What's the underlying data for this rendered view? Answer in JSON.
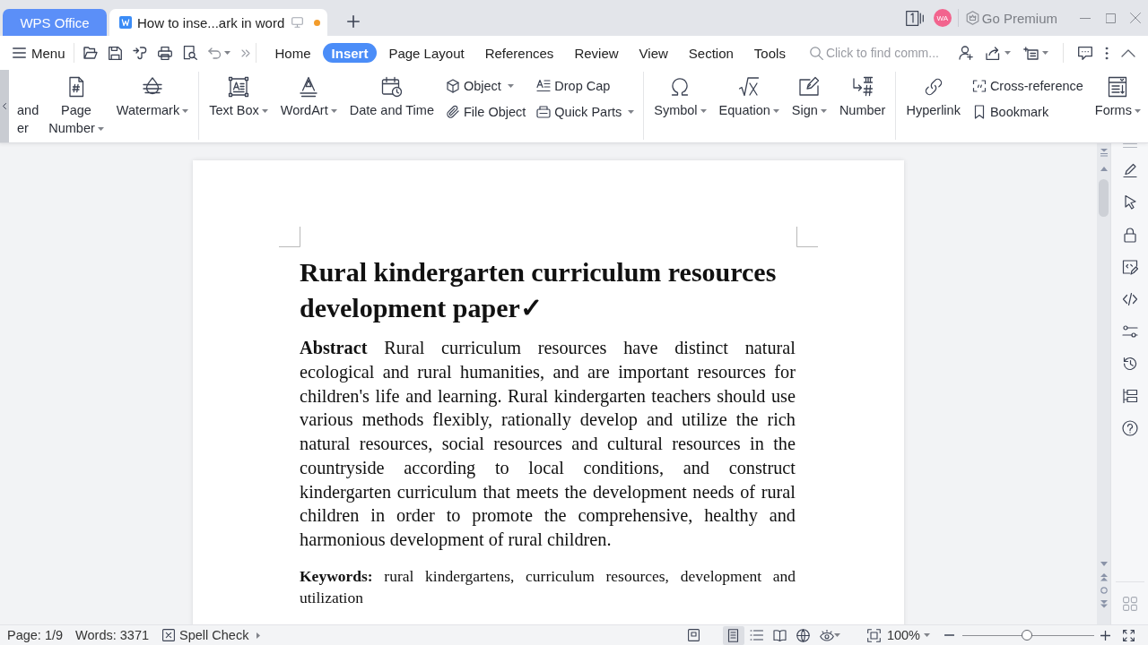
{
  "title_bar": {
    "tabs": [
      {
        "kind": "home",
        "label": "WPS Office",
        "selected": false
      },
      {
        "kind": "document",
        "label": "How to inse...ark in word",
        "selected": true,
        "unsaved": true
      }
    ],
    "account": {
      "initials": "WA"
    },
    "premium": "Go Premium"
  },
  "toolbar": {
    "menu": "Menu",
    "tabs": [
      {
        "label": "Home",
        "selected": false
      },
      {
        "label": "Insert",
        "selected": true
      },
      {
        "label": "Page Layout",
        "selected": false
      },
      {
        "label": "References",
        "selected": false
      },
      {
        "label": "Review",
        "selected": false
      },
      {
        "label": "View",
        "selected": false
      },
      {
        "label": "Section",
        "selected": false
      },
      {
        "label": "Tools",
        "selected": false
      }
    ],
    "search": {
      "placeholder": "Click to find comm..."
    }
  },
  "ribbon": {
    "groups": [
      {
        "items": [
          {
            "kind": "cut",
            "label": "and\ner"
          },
          {
            "kind": "large",
            "label": "Page\nNumber",
            "dropdown": true
          },
          {
            "kind": "large",
            "label": "Watermark",
            "dropdown": true
          }
        ]
      },
      {
        "items": [
          {
            "kind": "large",
            "label": "Text Box",
            "dropdown": true
          },
          {
            "kind": "large",
            "label": "WordArt",
            "dropdown": true
          },
          {
            "kind": "large",
            "label": "Date and Time",
            "dropdown": false
          },
          {
            "kind": "stack",
            "items": [
              {
                "label": "Object",
                "dropdown": true
              },
              {
                "label": "File Object",
                "dropdown": false
              }
            ]
          },
          {
            "kind": "stack",
            "items": [
              {
                "label": "Drop Cap",
                "dropdown": false
              },
              {
                "label": "Quick Parts",
                "dropdown": true
              }
            ]
          }
        ]
      },
      {
        "items": [
          {
            "kind": "large",
            "label": "Symbol",
            "dropdown": true
          },
          {
            "kind": "large",
            "label": "Equation",
            "dropdown": true
          },
          {
            "kind": "large",
            "label": "Sign",
            "dropdown": true
          },
          {
            "kind": "large",
            "label": "Number",
            "dropdown": false
          }
        ]
      },
      {
        "items": [
          {
            "kind": "large",
            "label": "Hyperlink",
            "dropdown": false
          },
          {
            "kind": "stack",
            "items": [
              {
                "label": "Cross-reference",
                "dropdown": false
              },
              {
                "label": "Bookmark",
                "dropdown": false
              }
            ]
          },
          {
            "kind": "large",
            "label": "Forms",
            "dropdown": true
          }
        ]
      }
    ]
  },
  "document": {
    "title": "Rural kindergarten curriculum resources development paper✓",
    "abstract": "**Abstract** Rural curriculum resources have distinct natural ecological and rural humanities, and are important resources for children's life and learning. Rural kindergarten teachers should use various methods flexibly, rationally develop and utilize the rich natural resources, social resources and cultural resources in the countryside according to local conditions, and construct kindergarten curriculum that meets the development needs of rural children in order to promote the comprehensive, healthy and harmonious development of rural children.",
    "keywords": "**Keywords:** rural kindergartens, curriculum resources, development and utilization"
  },
  "status_bar": {
    "page": "Page: 1/9",
    "words": "Words: 3371",
    "spell_check": "Spell Check",
    "view_modes": [
      {
        "selected": true
      },
      {
        "selected": false
      },
      {
        "selected": false
      },
      {
        "selected": false
      }
    ],
    "zoom": {
      "value": "100%",
      "level": 0.49
    }
  }
}
